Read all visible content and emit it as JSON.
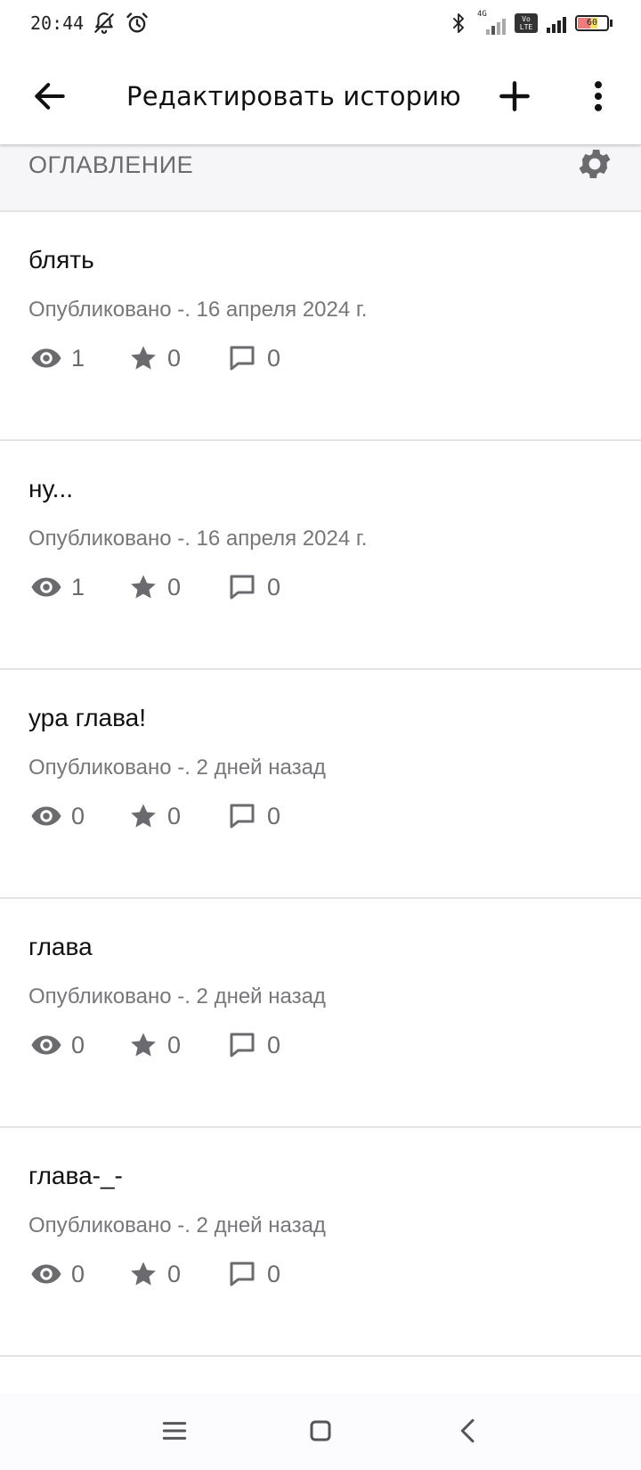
{
  "status_bar": {
    "time": "20:44",
    "left_icons": [
      "bell-off-icon",
      "alarm-icon"
    ],
    "right_icons": [
      "bluetooth-icon",
      "signal-4g-icon",
      "volte-icon",
      "signal-icon",
      "battery-icon"
    ],
    "network_type": "4G",
    "volte_label": "Vo LTE",
    "battery_level": "60"
  },
  "app_bar": {
    "title": "Редактировать историю",
    "back_icon": "arrow-left-icon",
    "add_icon": "plus-icon",
    "more_icon": "more-vertical-icon"
  },
  "toc": {
    "header": "ОГЛАВЛЕНИЕ",
    "settings_icon": "gear-icon"
  },
  "chapters": [
    {
      "title": "блять",
      "meta": "Опубликовано -. 16 апреля 2024 г.",
      "views": "1",
      "votes": "0",
      "comments": "0"
    },
    {
      "title": "ну...",
      "meta": "Опубликовано -. 16 апреля 2024 г.",
      "views": "1",
      "votes": "0",
      "comments": "0"
    },
    {
      "title": "ура глава!",
      "meta": "Опубликовано -. 2 дней назад",
      "views": "0",
      "votes": "0",
      "comments": "0"
    },
    {
      "title": "глава",
      "meta": "Опубликовано -. 2 дней назад",
      "views": "0",
      "votes": "0",
      "comments": "0"
    },
    {
      "title": "глава-_-",
      "meta": "Опубликовано -. 2 дней назад",
      "views": "0",
      "votes": "0",
      "comments": "0"
    }
  ],
  "nav_bar": {
    "icons": [
      "menu-icon",
      "home-square-icon",
      "back-chevron-icon"
    ]
  },
  "colors": {
    "icon_gray": "#6b6b6f",
    "meta_gray": "#77767b",
    "header_bg": "#f6f5f8",
    "divider": "#e4e3e6"
  }
}
